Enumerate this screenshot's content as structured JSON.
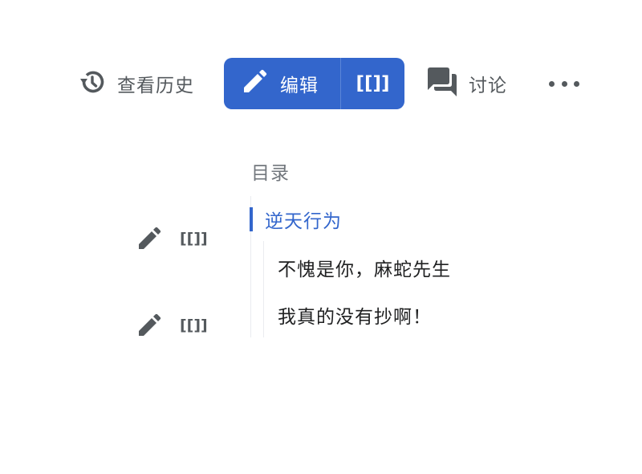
{
  "toolbar": {
    "history_label": "查看历史",
    "edit_label": "编辑",
    "edit_source_label": "[[]]",
    "talk_label": "讨论"
  },
  "section_edits": [
    {
      "source_label": "[[]]"
    },
    {
      "source_label": "[[]]"
    }
  ],
  "toc": {
    "title": "目录",
    "items": [
      {
        "label": "逆天行为",
        "active": true
      },
      {
        "label": "不愧是你，麻蛇先生"
      },
      {
        "label": "我真的没有抄啊！"
      }
    ]
  },
  "colors": {
    "accent": "#3366cc",
    "icon": "#54595d",
    "text": "#202122",
    "muted": "#72777d"
  },
  "icons": [
    "history-icon",
    "pencil-icon",
    "speech-bubbles-icon",
    "ellipsis-icon"
  ]
}
